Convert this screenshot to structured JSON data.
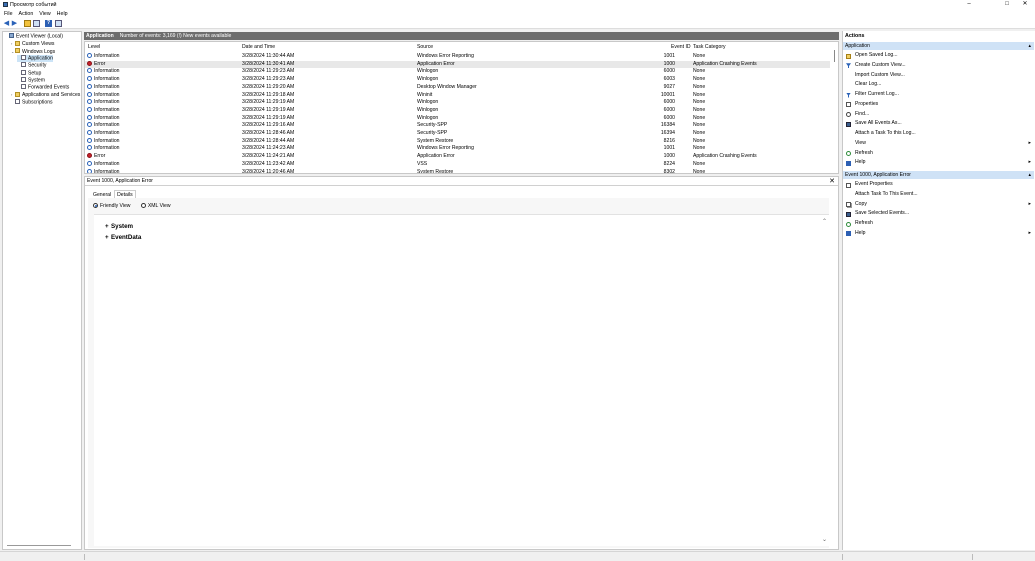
{
  "window": {
    "title": "Просмотр событий",
    "controls": {
      "minimize": "–",
      "maximize": "□",
      "close": "✕"
    }
  },
  "menu": [
    "File",
    "Action",
    "View",
    "Help"
  ],
  "toolbar": {
    "icons": [
      "back-arrow-icon",
      "forward-arrow-icon",
      "folder-up-icon",
      "show-hide-tree-icon",
      "help-icon",
      "properties-pane-icon"
    ]
  },
  "tree": {
    "items": [
      {
        "label": "Event Viewer (Local)",
        "level": 0,
        "expander": "",
        "icon": "event-viewer-icon"
      },
      {
        "label": "Custom Views",
        "level": 1,
        "expander": "›",
        "icon": "folder-icon"
      },
      {
        "label": "Windows Logs",
        "level": 1,
        "expander": "⌄",
        "icon": "folder-icon"
      },
      {
        "label": "Application",
        "level": 2,
        "expander": "",
        "icon": "log-icon",
        "selected": true
      },
      {
        "label": "Security",
        "level": 2,
        "expander": "",
        "icon": "log-icon"
      },
      {
        "label": "Setup",
        "level": 2,
        "expander": "",
        "icon": "log-icon"
      },
      {
        "label": "System",
        "level": 2,
        "expander": "",
        "icon": "log-icon"
      },
      {
        "label": "Forwarded Events",
        "level": 2,
        "expander": "",
        "icon": "log-icon"
      },
      {
        "label": "Applications and Services Lo",
        "level": 1,
        "expander": "›",
        "icon": "folder-icon"
      },
      {
        "label": "Subscriptions",
        "level": 1,
        "expander": "",
        "icon": "log-icon"
      }
    ]
  },
  "log": {
    "name": "Application",
    "summary": "Number of events: 3,169 (!) New events available",
    "columns": {
      "level": "Level",
      "date": "Date and Time",
      "source": "Source",
      "event_id": "Event ID",
      "task": "Task Category"
    },
    "rows": [
      {
        "level": "Information",
        "type": "info",
        "date": "3/28/2024 11:30:44 AM",
        "source": "Windows Error Reporting",
        "event_id": "1001",
        "task": "None"
      },
      {
        "level": "Error",
        "type": "error",
        "date": "3/28/2024 11:30:41 AM",
        "source": "Application Error",
        "event_id": "1000",
        "task": "Application Crashing Events",
        "selected": true
      },
      {
        "level": "Information",
        "type": "info",
        "date": "3/28/2024 11:29:23 AM",
        "source": "Winlogon",
        "event_id": "6000",
        "task": "None"
      },
      {
        "level": "Information",
        "type": "info",
        "date": "3/28/2024 11:29:23 AM",
        "source": "Winlogon",
        "event_id": "6003",
        "task": "None"
      },
      {
        "level": "Information",
        "type": "info",
        "date": "3/28/2024 11:29:20 AM",
        "source": "Desktop Window Manager",
        "event_id": "9027",
        "task": "None"
      },
      {
        "level": "Information",
        "type": "info",
        "date": "3/28/2024 11:29:18 AM",
        "source": "Wininit",
        "event_id": "10001",
        "task": "None"
      },
      {
        "level": "Information",
        "type": "info",
        "date": "3/28/2024 11:29:19 AM",
        "source": "Winlogon",
        "event_id": "6000",
        "task": "None"
      },
      {
        "level": "Information",
        "type": "info",
        "date": "3/28/2024 11:29:19 AM",
        "source": "Winlogon",
        "event_id": "6000",
        "task": "None"
      },
      {
        "level": "Information",
        "type": "info",
        "date": "3/28/2024 11:29:19 AM",
        "source": "Winlogon",
        "event_id": "6000",
        "task": "None"
      },
      {
        "level": "Information",
        "type": "info",
        "date": "3/28/2024 11:29:16 AM",
        "source": "Security-SPP",
        "event_id": "16384",
        "task": "None"
      },
      {
        "level": "Information",
        "type": "info",
        "date": "3/28/2024 11:28:46 AM",
        "source": "Security-SPP",
        "event_id": "16394",
        "task": "None"
      },
      {
        "level": "Information",
        "type": "info",
        "date": "3/28/2024 11:28:44 AM",
        "source": "System Restore",
        "event_id": "8216",
        "task": "None"
      },
      {
        "level": "Information",
        "type": "info",
        "date": "3/28/2024 11:24:23 AM",
        "source": "Windows Error Reporting",
        "event_id": "1001",
        "task": "None"
      },
      {
        "level": "Error",
        "type": "error",
        "date": "3/28/2024 11:24:21 AM",
        "source": "Application Error",
        "event_id": "1000",
        "task": "Application Crashing Events"
      },
      {
        "level": "Information",
        "type": "info",
        "date": "3/28/2024 11:23:42 AM",
        "source": "VSS",
        "event_id": "8224",
        "task": "None"
      },
      {
        "level": "Information",
        "type": "info",
        "date": "3/28/2024 11:20:46 AM",
        "source": "System Restore",
        "event_id": "8302",
        "task": "None"
      }
    ]
  },
  "detail": {
    "title": "Event 1000, Application Error",
    "tabs": [
      "General",
      "Details"
    ],
    "active_tab": "Details",
    "views": {
      "friendly": "Friendly View",
      "xml": "XML View",
      "selected": "friendly"
    },
    "sections": [
      "System",
      "EventData"
    ],
    "expand_symbol": "+"
  },
  "actions": {
    "header": "Actions",
    "sections": [
      {
        "title": "Application",
        "items": [
          {
            "label": "Open Saved Log...",
            "icon": "open-log-icon",
            "submenu": false
          },
          {
            "label": "Create Custom View...",
            "icon": "filter-icon",
            "submenu": false
          },
          {
            "label": "Import Custom View...",
            "icon": "",
            "submenu": false
          },
          {
            "label": "Clear Log...",
            "icon": "",
            "submenu": false
          },
          {
            "label": "Filter Current Log...",
            "icon": "filter-icon",
            "submenu": false
          },
          {
            "label": "Properties",
            "icon": "properties-icon",
            "submenu": false
          },
          {
            "label": "Find...",
            "icon": "find-icon",
            "submenu": false
          },
          {
            "label": "Save All Events As...",
            "icon": "save-icon",
            "submenu": false
          },
          {
            "label": "Attach a Task To this Log...",
            "icon": "",
            "submenu": false
          },
          {
            "label": "View",
            "icon": "",
            "submenu": true
          },
          {
            "label": "Refresh",
            "icon": "refresh-icon",
            "submenu": false
          },
          {
            "label": "Help",
            "icon": "help-icon",
            "submenu": true
          }
        ]
      },
      {
        "title": "Event 1000, Application Error",
        "items": [
          {
            "label": "Event Properties",
            "icon": "properties-icon",
            "submenu": false
          },
          {
            "label": "Attach Task To This Event...",
            "icon": "",
            "submenu": false
          },
          {
            "label": "Copy",
            "icon": "copy-icon",
            "submenu": true
          },
          {
            "label": "Save Selected Events...",
            "icon": "save-icon",
            "submenu": false
          },
          {
            "label": "Refresh",
            "icon": "refresh-icon",
            "submenu": false
          },
          {
            "label": "Help",
            "icon": "help-icon",
            "submenu": true
          }
        ]
      }
    ],
    "collapse_symbol": "▴",
    "submenu_symbol": "▸"
  }
}
